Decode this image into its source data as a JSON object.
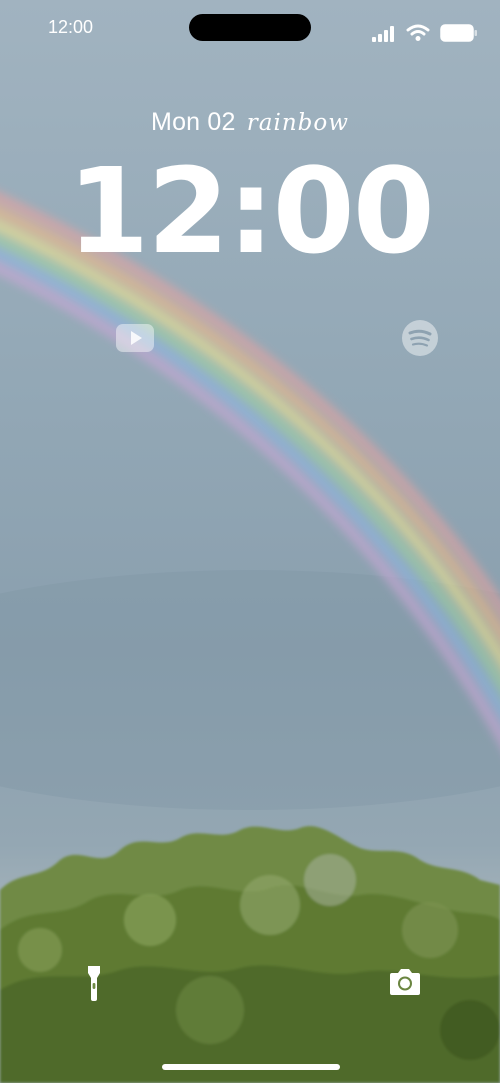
{
  "status_bar": {
    "time": "12:00",
    "icons": [
      "cellular-signal-icon",
      "wifi-icon",
      "battery-icon"
    ]
  },
  "lock_screen": {
    "date": "Mon 02",
    "date_word": "rainbow",
    "clock": "12:00"
  },
  "widgets": [
    {
      "name": "youtube",
      "icon": "youtube-icon"
    },
    {
      "name": "spotify",
      "icon": "spotify-icon"
    }
  ],
  "quick_actions": [
    {
      "name": "flashlight",
      "icon": "flashlight-icon"
    },
    {
      "name": "camera",
      "icon": "camera-icon"
    }
  ],
  "colors": {
    "text": "#ffffff",
    "sky": "#95a9b7",
    "foliage": "#5f7a3c"
  }
}
